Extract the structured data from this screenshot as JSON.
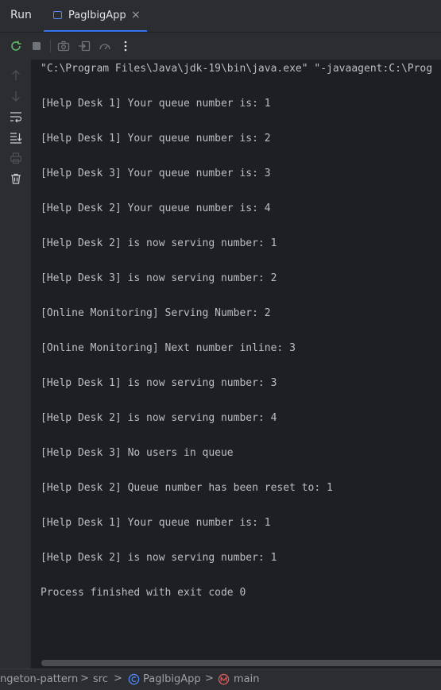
{
  "tool_window": {
    "title": "Run"
  },
  "tab": {
    "title": "PaglbigApp",
    "close": "×"
  },
  "console": {
    "lines": [
      "\"C:\\Program Files\\Java\\jdk-19\\bin\\java.exe\" \"-javaagent:C:\\Prog",
      "[Help Desk 1] Your queue number is: 1",
      "[Help Desk 1] Your queue number is: 2",
      "[Help Desk 3] Your queue number is: 3",
      "[Help Desk 2] Your queue number is: 4",
      "[Help Desk 2] is now serving number: 1",
      "[Help Desk 3] is now serving number: 2",
      "[Online Monitoring] Serving Number: 2",
      "[Online Monitoring] Next number inline: 3",
      "[Help Desk 1] is now serving number: 3",
      "[Help Desk 2] is now serving number: 4",
      "[Help Desk 3] No users in queue",
      "[Help Desk 2] Queue number has been reset to: 1",
      "[Help Desk 1] Your queue number is: 1",
      "[Help Desk 2] is now serving number: 1",
      "Process finished with exit code 0"
    ]
  },
  "breadcrumb": {
    "project": "ngeton-pattern",
    "folder": "src",
    "class": "PaglbigApp",
    "method": "main",
    "separator": ">"
  },
  "icons": {
    "toolbar": [
      "rerun-icon",
      "stop-icon",
      "camera-icon",
      "exit-icon",
      "gauge-icon",
      "more-icon"
    ],
    "sidebar": [
      "arrow-up-icon",
      "arrow-down-icon",
      "soft-wrap-icon",
      "scroll-to-end-icon",
      "print-icon",
      "trash-icon"
    ]
  },
  "colors": {
    "accent": "#3574f0",
    "background": "#1e1f22",
    "panel": "#2b2d30",
    "text": "#bcbec4"
  }
}
